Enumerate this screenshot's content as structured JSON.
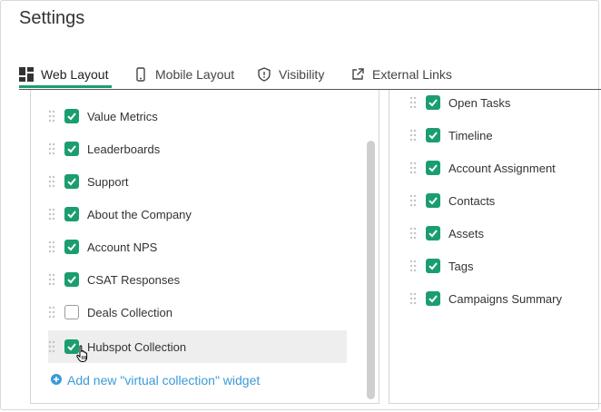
{
  "page": {
    "title": "Settings"
  },
  "tabs": [
    {
      "label": "Web Layout",
      "icon": "layout-grid-icon",
      "active": true
    },
    {
      "label": "Mobile Layout",
      "icon": "mobile-phone-icon",
      "active": false
    },
    {
      "label": "Visibility",
      "icon": "shield-icon",
      "active": false
    },
    {
      "label": "External Links",
      "icon": "external-link-icon",
      "active": false
    }
  ],
  "left_widgets": [
    {
      "label": "Value Metrics",
      "checked": true
    },
    {
      "label": "Leaderboards",
      "checked": true
    },
    {
      "label": "Support",
      "checked": true
    },
    {
      "label": "About the Company",
      "checked": true
    },
    {
      "label": "Account NPS",
      "checked": true
    },
    {
      "label": "CSAT Responses",
      "checked": true
    },
    {
      "label": "Deals Collection",
      "checked": false
    },
    {
      "label": "Hubspot Collection",
      "checked": true
    }
  ],
  "add_widget": {
    "label": "Add new \"virtual collection\" widget"
  },
  "right_widgets": [
    {
      "label": "Open Tasks",
      "checked": true
    },
    {
      "label": "Timeline",
      "checked": true
    },
    {
      "label": "Account Assignment",
      "checked": true
    },
    {
      "label": "Contacts",
      "checked": true
    },
    {
      "label": "Assets",
      "checked": true
    },
    {
      "label": "Tags",
      "checked": true
    },
    {
      "label": "Campaigns Summary",
      "checked": true
    }
  ],
  "colors": {
    "accent": "#1b9e6f",
    "link": "#3a9bd6"
  }
}
